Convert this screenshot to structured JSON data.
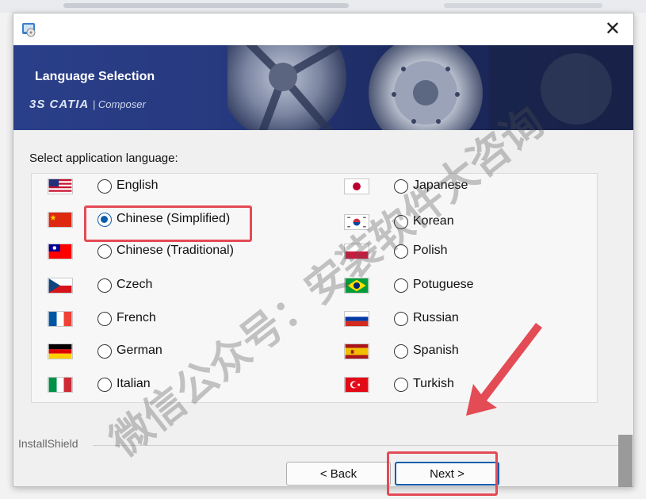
{
  "window": {
    "close_glyph": "✕"
  },
  "banner": {
    "title": "Language Selection",
    "brand": "CATIA",
    "brand_sub": "| Composer",
    "brand_prefix": "3S"
  },
  "prompt": "Select application language:",
  "languages_left": [
    {
      "label": "English",
      "flag": "us-flag-icon",
      "checked": false
    },
    {
      "label": "Chinese (Simplified)",
      "flag": "cn-flag-icon",
      "checked": true
    },
    {
      "label": "Chinese (Traditional)",
      "flag": "tw-flag-icon",
      "checked": false
    },
    {
      "label": "Czech",
      "flag": "cz-flag-icon",
      "checked": false
    },
    {
      "label": "French",
      "flag": "fr-flag-icon",
      "checked": false
    },
    {
      "label": "German",
      "flag": "de-flag-icon",
      "checked": false
    },
    {
      "label": "Italian",
      "flag": "it-flag-icon",
      "checked": false
    }
  ],
  "languages_right": [
    {
      "label": "Japanese",
      "flag": "jp-flag-icon",
      "checked": false
    },
    {
      "label": "Korean",
      "flag": "kr-flag-icon",
      "checked": false
    },
    {
      "label": "Polish",
      "flag": "pl-flag-icon",
      "checked": false
    },
    {
      "label": "Potuguese",
      "flag": "br-flag-icon",
      "checked": false
    },
    {
      "label": "Russian",
      "flag": "ru-flag-icon",
      "checked": false
    },
    {
      "label": "Spanish",
      "flag": "es-flag-icon",
      "checked": false
    },
    {
      "label": "Turkish",
      "flag": "tr-flag-icon",
      "checked": false
    }
  ],
  "footer": {
    "brand": "InstallShield",
    "back_label": "< Back",
    "next_label": "Next >"
  },
  "watermark": "微信公众号：安装软件大咨询",
  "colors": {
    "highlight": "#e34b55",
    "radio_checked": "#0b5cad",
    "banner": "#27397e"
  }
}
